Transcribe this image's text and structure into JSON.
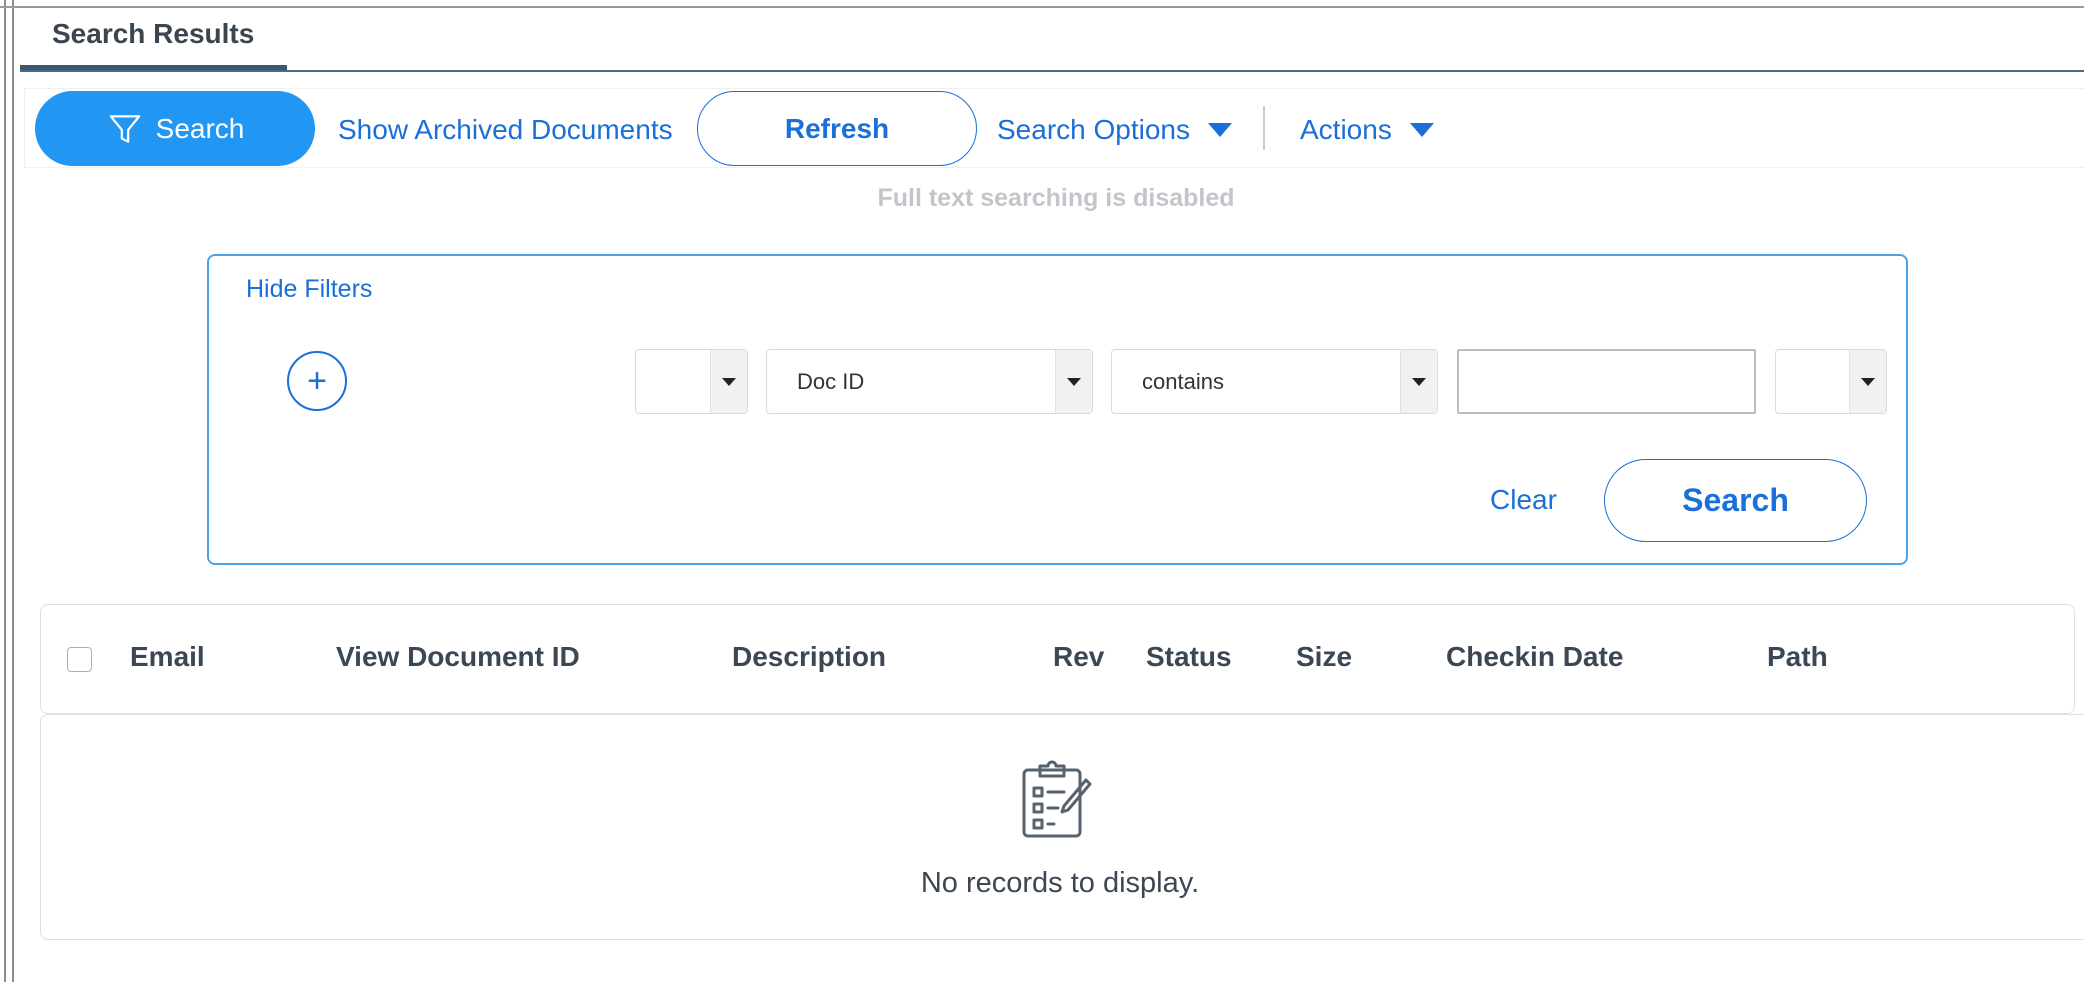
{
  "tab": {
    "label": "Search Results"
  },
  "toolbar": {
    "search_label": "Search",
    "show_archived_label": "Show Archived Documents",
    "refresh_label": "Refresh",
    "search_options_label": "Search Options",
    "actions_label": "Actions"
  },
  "notice": "Full text searching is disabled",
  "filters": {
    "hide_label": "Hide Filters",
    "add_symbol": "+",
    "prefix_select_value": "",
    "field_select_value": "Doc ID",
    "operator_select_value": "contains",
    "value_input": "",
    "suffix_select_value": "",
    "clear_label": "Clear",
    "search_label": "Search"
  },
  "grid": {
    "columns": [
      "Email",
      "View Document ID",
      "Description",
      "Rev",
      "Status",
      "Size",
      "Checkin Date",
      "Path"
    ],
    "empty_message": "No records to display."
  },
  "colors": {
    "accent": "#2196f3",
    "link": "#1a6fd8",
    "text": "#3b4754"
  },
  "icons": [
    "filter-icon",
    "caret-down-icon",
    "plus-icon",
    "clipboard-checklist-icon"
  ]
}
